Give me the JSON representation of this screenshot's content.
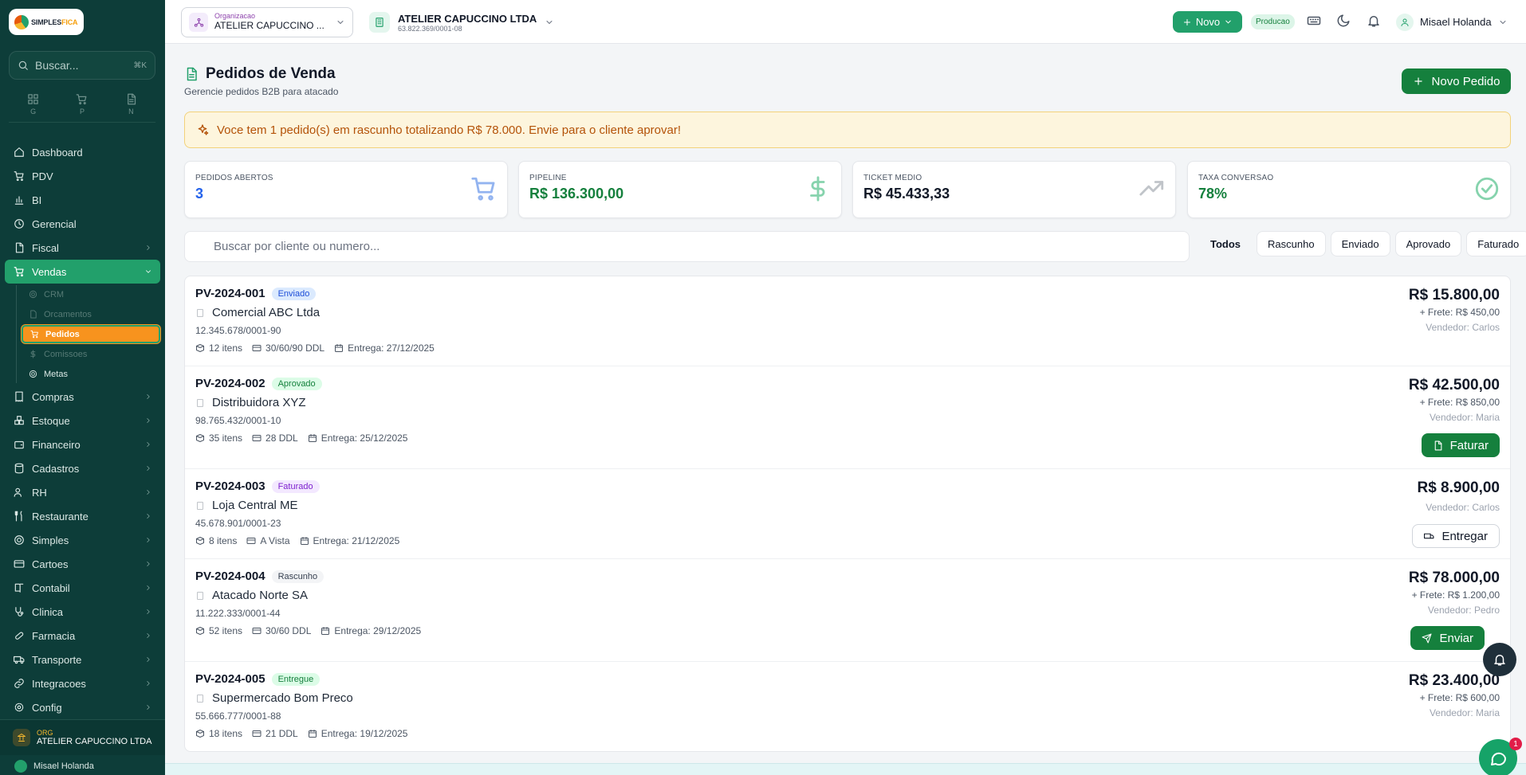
{
  "sidebar": {
    "logo_text_a": "SIMPLES",
    "logo_text_b": "FICA",
    "search_placeholder": "Buscar...",
    "search_shortcut": "⌘K",
    "quick": [
      {
        "label": "G",
        "icon": "grid-icon"
      },
      {
        "label": "P",
        "icon": "cart-icon"
      },
      {
        "label": "N",
        "icon": "document-icon"
      }
    ],
    "items": [
      {
        "label": "Dashboard",
        "icon": "home-icon"
      },
      {
        "label": "PDV",
        "icon": "cart-icon"
      },
      {
        "label": "BI",
        "icon": "bar-chart-icon"
      },
      {
        "label": "Gerencial",
        "icon": "clock-icon"
      },
      {
        "label": "Fiscal",
        "icon": "document-icon"
      },
      {
        "label": "Vendas",
        "icon": "cart-icon"
      },
      {
        "label": "Compras",
        "icon": "receipt-icon"
      },
      {
        "label": "Estoque",
        "icon": "boxes-icon"
      },
      {
        "label": "Financeiro",
        "icon": "wallet-icon"
      },
      {
        "label": "Cadastros",
        "icon": "database-icon"
      },
      {
        "label": "RH",
        "icon": "users-icon"
      },
      {
        "label": "Restaurante",
        "icon": "utensils-icon"
      },
      {
        "label": "Simples",
        "icon": "target-icon"
      },
      {
        "label": "Cartoes",
        "icon": "credit-card-icon"
      },
      {
        "label": "Contabil",
        "icon": "book-icon"
      },
      {
        "label": "Clinica",
        "icon": "stethoscope-icon"
      },
      {
        "label": "Farmacia",
        "icon": "pill-icon"
      },
      {
        "label": "Transporte",
        "icon": "truck-icon"
      },
      {
        "label": "Integracoes",
        "icon": "link-icon"
      },
      {
        "label": "Config",
        "icon": "gear-icon"
      }
    ],
    "vendas_sub": [
      {
        "label": "CRM",
        "icon": "target-icon"
      },
      {
        "label": "Orcamentos",
        "icon": "document-icon"
      },
      {
        "label": "Pedidos",
        "icon": "cart-icon"
      },
      {
        "label": "Comissoes",
        "icon": "dollar-icon"
      },
      {
        "label": "Metas",
        "icon": "target-icon"
      }
    ],
    "org_label": "ORG",
    "org_name": "ATELIER CAPUCCINO LTDA",
    "user_name": "Misael Holanda"
  },
  "topbar": {
    "org_small": "Organizacao",
    "org_name": "ATELIER CAPUCCINO ...",
    "company_name": "ATELIER CAPUCCINO LTDA",
    "company_cnpj": "63.822.369/0001-08",
    "novo_label": "Novo",
    "env_badge": "Producao",
    "user_name": "Misael Holanda"
  },
  "page": {
    "title": "Pedidos de Venda",
    "subtitle": "Gerencie pedidos B2B para atacado",
    "new_order_label": "Novo Pedido",
    "alert_text": "Voce tem 1 pedido(s) em rascunho totalizando R$ 78.000. Envie para o cliente aprovar!"
  },
  "stats": [
    {
      "label": "PEDIDOS ABERTOS",
      "value": "3",
      "value_color": "#2563eb",
      "icon": "cart-icon",
      "icon_color": "#93b4f0"
    },
    {
      "label": "PIPELINE",
      "value": "R$ 136.300,00",
      "value_color": "#15803d",
      "icon": "dollar-icon",
      "icon_color": "#86d3ad"
    },
    {
      "label": "TICKET MEDIO",
      "value": "R$ 45.433,33",
      "value_color": "#111827",
      "icon": "trending-up-icon",
      "icon_color": "#c0c4c9"
    },
    {
      "label": "TAXA CONVERSAO",
      "value": "78%",
      "value_color": "#15803d",
      "icon": "check-circle-icon",
      "icon_color": "#86d3ad"
    }
  ],
  "filters": {
    "search_placeholder": "Buscar por cliente ou numero...",
    "chips": [
      "Todos",
      "Rascunho",
      "Enviado",
      "Aprovado",
      "Faturado"
    ],
    "active": "Todos"
  },
  "orders": [
    {
      "id": "PV-2024-001",
      "status": "Enviado",
      "status_bg": "#dbeafe",
      "status_fg": "#1d4ed8",
      "client": "Comercial ABC Ltda",
      "cnpj": "12.345.678/0001-90",
      "items": "12 itens",
      "terms": "30/60/90 DDL",
      "delivery": "Entrega: 27/12/2025",
      "total": "R$ 15.800,00",
      "frete": "+ Frete: R$ 450,00",
      "vendedor": "Vendedor: Carlos",
      "action": ""
    },
    {
      "id": "PV-2024-002",
      "status": "Aprovado",
      "status_bg": "#dcfce7",
      "status_fg": "#15803d",
      "client": "Distribuidora XYZ",
      "cnpj": "98.765.432/0001-10",
      "items": "35 itens",
      "terms": "28 DDL",
      "delivery": "Entrega: 25/12/2025",
      "total": "R$ 42.500,00",
      "frete": "+ Frete: R$ 850,00",
      "vendedor": "Vendedor: Maria",
      "action": "Faturar"
    },
    {
      "id": "PV-2024-003",
      "status": "Faturado",
      "status_bg": "#f3e8ff",
      "status_fg": "#7e22ce",
      "client": "Loja Central ME",
      "cnpj": "45.678.901/0001-23",
      "items": "8 itens",
      "terms": "A Vista",
      "delivery": "Entrega: 21/12/2025",
      "total": "R$ 8.900,00",
      "frete": "",
      "vendedor": "Vendedor: Carlos",
      "action": "Entregar"
    },
    {
      "id": "PV-2024-004",
      "status": "Rascunho",
      "status_bg": "#f3f4f6",
      "status_fg": "#374151",
      "client": "Atacado Norte SA",
      "cnpj": "11.222.333/0001-44",
      "items": "52 itens",
      "terms": "30/60 DDL",
      "delivery": "Entrega: 29/12/2025",
      "total": "R$ 78.000,00",
      "frete": "+ Frete: R$ 1.200,00",
      "vendedor": "Vendedor: Pedro",
      "action": "Enviar"
    },
    {
      "id": "PV-2024-005",
      "status": "Entregue",
      "status_bg": "#dcfce7",
      "status_fg": "#15803d",
      "client": "Supermercado Bom Preco",
      "cnpj": "55.666.777/0001-88",
      "items": "18 itens",
      "terms": "21 DDL",
      "delivery": "Entrega: 19/12/2025",
      "total": "R$ 23.400,00",
      "frete": "+ Frete: R$ 600,00",
      "vendedor": "Vendedor: Maria",
      "action": ""
    }
  ],
  "chat_badge": "1"
}
